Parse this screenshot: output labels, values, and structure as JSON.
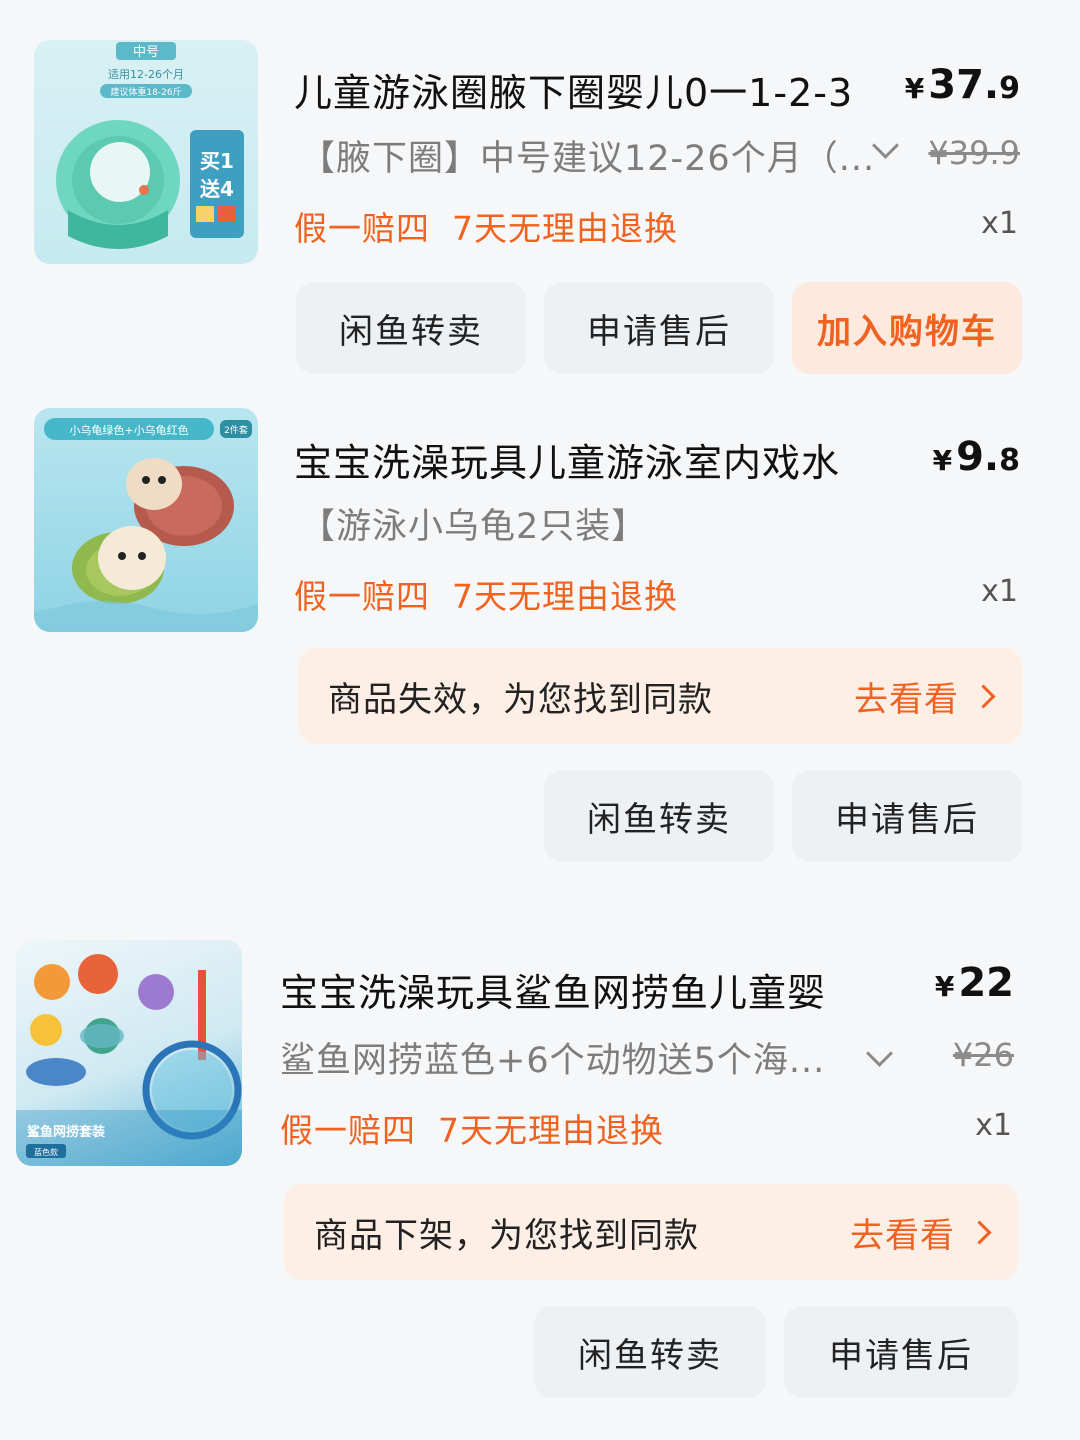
{
  "orders": [
    {
      "title": "儿童游泳圈腋下圈婴儿0一1-2-3",
      "price_symbol": "¥",
      "price_int": "37.",
      "price_dec": "9",
      "variant": "【腋下圈】中号建议12-26个月（...",
      "old_price": "¥39.9",
      "guarantees": [
        "假一赔四",
        "7天无理由退换"
      ],
      "qty": "x1",
      "thumb": {
        "badge": "中号",
        "line1": "适用12-26个月",
        "line2": "建议体重18-26斤",
        "promo1": "买1",
        "promo2": "送4"
      },
      "buttons": [
        "闲鱼转卖",
        "申请售后",
        "加入购物车"
      ]
    },
    {
      "title": "宝宝洗澡玩具儿童游泳室内戏水",
      "price_symbol": "¥",
      "price_int": "9.",
      "price_dec": "8",
      "variant": "【游泳小乌龟2只装】",
      "guarantees": [
        "假一赔四",
        "7天无理由退换"
      ],
      "qty": "x1",
      "thumb": {
        "banner": "小乌龟绿色+小乌龟红色",
        "tag": "2件套"
      },
      "notice": {
        "text": "商品失效，为您找到同款",
        "link": "去看看"
      },
      "buttons": [
        "闲鱼转卖",
        "申请售后"
      ]
    },
    {
      "title": "宝宝洗澡玩具鲨鱼网捞鱼儿童婴",
      "price_symbol": "¥",
      "price_int": "22",
      "price_dec": "",
      "variant": "鲨鱼网捞蓝色+6个动物送5个海...",
      "old_price": "¥26",
      "guarantees": [
        "假一赔四",
        "7天无理由退换"
      ],
      "qty": "x1",
      "thumb": {
        "label1": "鲨鱼网捞套装",
        "label2": "蓝色款"
      },
      "notice": {
        "text": "商品下架，为您找到同款",
        "link": "去看看"
      },
      "buttons": [
        "闲鱼转卖",
        "申请售后"
      ]
    }
  ],
  "colors": {
    "accent": "#f0621f",
    "button_bg": "#eef1f4",
    "notice_bg": "#fdeee6",
    "page_bg": "#f6f7f9"
  }
}
